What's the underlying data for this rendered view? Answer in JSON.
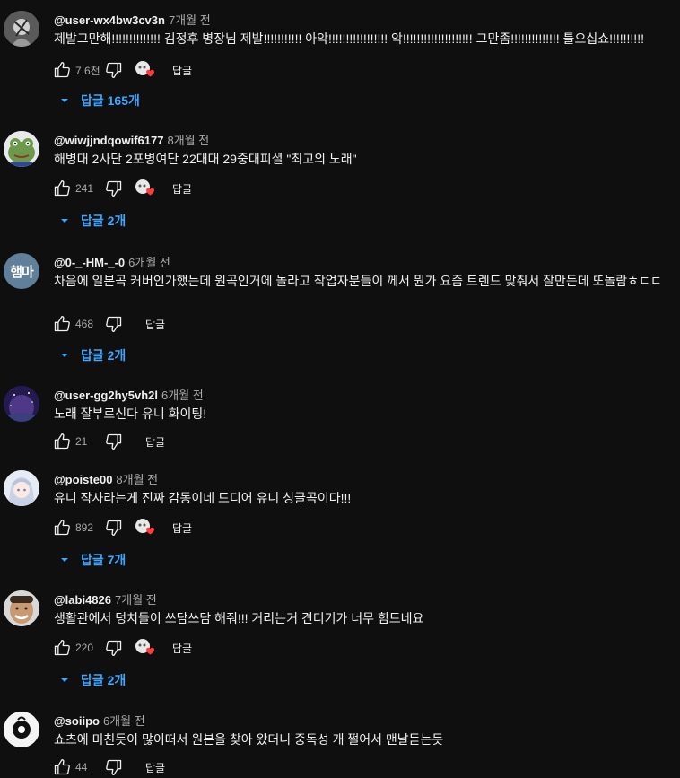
{
  "comments": [
    {
      "author": "@user-wx4bw3cv3n",
      "time": "7개월 전",
      "text": "제발그만해!!!!!!!!!!!!!! 김정후 병장님 제발!!!!!!!!!!! 아악!!!!!!!!!!!!!!!!! 악!!!!!!!!!!!!!!!!!!!! 그만좀!!!!!!!!!!!!!! 틀으십쇼!!!!!!!!!!",
      "likes": "7.6천",
      "reply_label": "답글",
      "replies_label": "답글 165개",
      "avatar": {
        "type": "image",
        "color": "#8a8a8a",
        "icon": "bw-photo-avatar"
      }
    },
    {
      "author": "@wiwjjndqowif6177",
      "time": "8개월 전",
      "text": "해병대 2사단 2포병여단 22대대 29중대피셜 \"최고의 노래\"",
      "likes": "241",
      "reply_label": "답글",
      "replies_label": "답글 2개",
      "avatar": {
        "type": "image",
        "color": "#7fae5a",
        "icon": "frog-avatar"
      }
    },
    {
      "author": "@0-_-HM-_-0",
      "time": "6개월 전",
      "text": "차음에 일본곡 커버인가했는데 원곡인거에 놀라고 작업자분들이 께서 뭔가 요즘 트렌드 맞춰서 잘만든데 또놀람ㅎㄷㄷㄷㄷ",
      "likes": "468",
      "reply_label": "답글",
      "replies_label": "답글 2개",
      "avatar": {
        "type": "text",
        "label": "햄마",
        "color": "#5f7f9a"
      }
    },
    {
      "author": "@user-gg2hy5vh2l",
      "time": "6개월 전",
      "text": "노래 잘부르신다 유니 화이팅!",
      "likes": "21",
      "reply_label": "답글",
      "avatar": {
        "type": "image",
        "color": "#3b2a6e",
        "icon": "galaxy-avatar"
      }
    },
    {
      "author": "@poiste00",
      "time": "8개월 전",
      "text": "유니 작사라는게 진짜 감동이네 드디어 유니 싱글곡이다!!!",
      "likes": "892",
      "reply_label": "답글",
      "replies_label": "답글 7개",
      "avatar": {
        "type": "image",
        "color": "#dfe4ef",
        "icon": "anime-avatar"
      }
    },
    {
      "author": "@labi4826",
      "time": "7개월 전",
      "text": "생활관에서 덩치들이 쓰담쓰담 해줘!!! 거리는거 견디기가 너무 힘드네요",
      "likes": "220",
      "reply_label": "답글",
      "replies_label": "답글 2개",
      "avatar": {
        "type": "image",
        "color": "#c9a27c",
        "icon": "face-avatar"
      }
    },
    {
      "author": "@soiipo",
      "time": "6개월 전",
      "text": "쇼츠에 미친듯이 많이떠서 원본을 찾아 왔더니 중독성 개 쩔어서 맨날듣는듯",
      "likes": "44",
      "reply_label": "답글",
      "avatar": {
        "type": "image",
        "color": "#f2f2f2",
        "icon": "ghost-avatar"
      }
    }
  ],
  "colors": {
    "background": "#0f0f0f",
    "link": "#3ea6ff",
    "heart": "#ff3b3b",
    "muted": "#aaaaaa"
  }
}
